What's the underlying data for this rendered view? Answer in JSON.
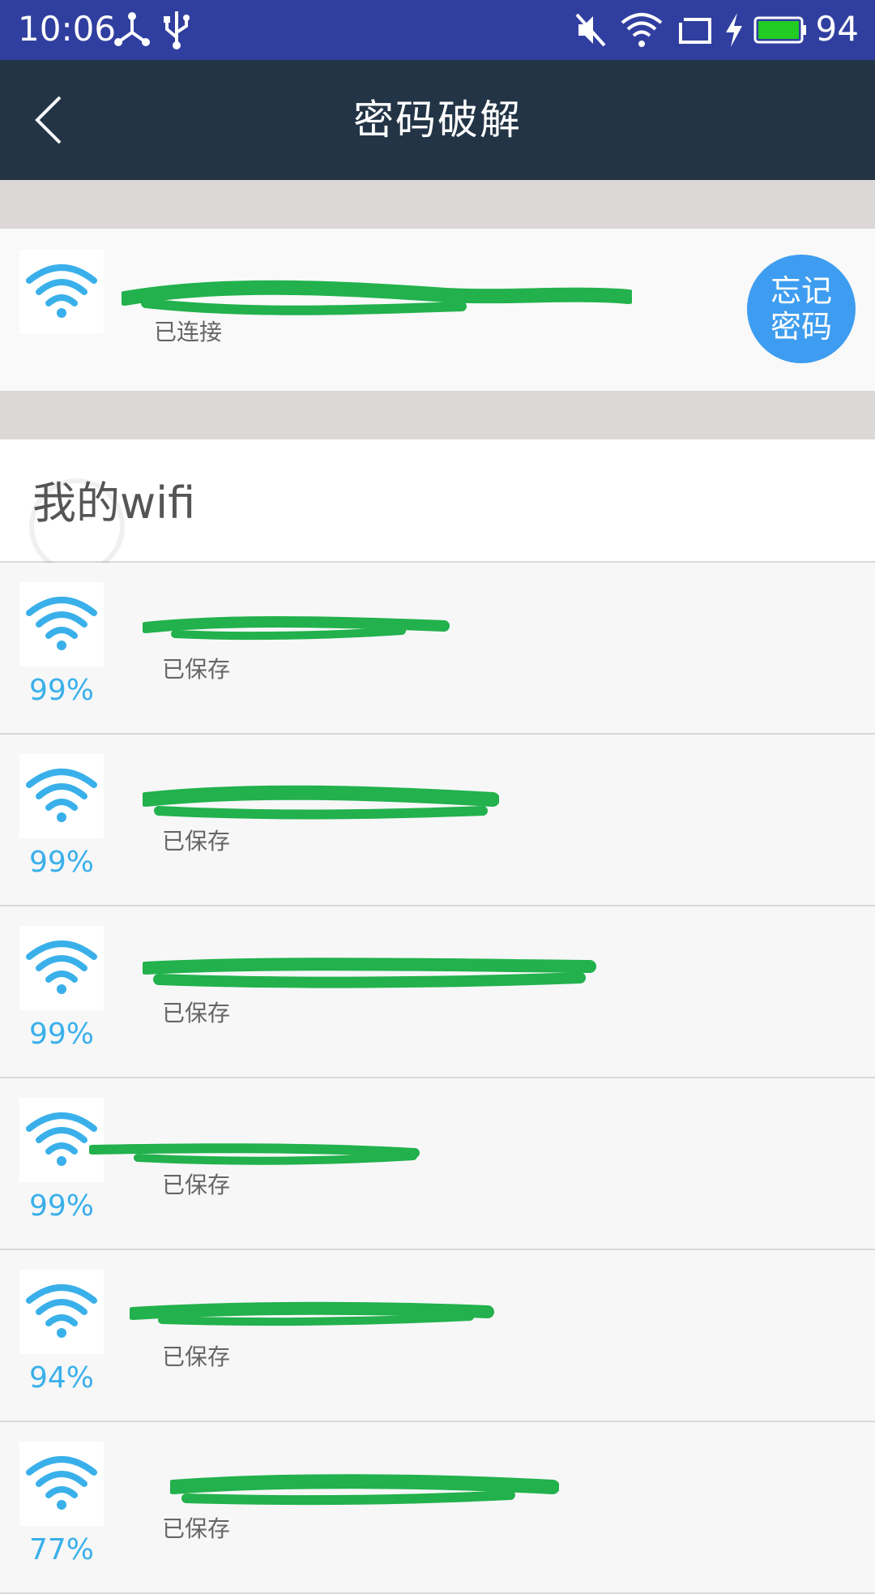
{
  "status_bar": {
    "time": "10:06",
    "battery_level": "94",
    "icons": [
      "network-share-icon",
      "usb-icon",
      "mute-icon",
      "wifi-signal-icon",
      "cast-icon",
      "charging-icon",
      "battery-icon"
    ],
    "colors": {
      "background": "#303f9f",
      "battery_fill": "#22cc22"
    }
  },
  "toolbar": {
    "title": "密码破解",
    "back_icon": "back-arrow-icon",
    "background": "#233446"
  },
  "connected": {
    "status": "已连接",
    "forget_button": "忘记密码",
    "forget_color": "#3e9df0"
  },
  "section": {
    "title": "我的wifi"
  },
  "networks": [
    {
      "signal": "99%",
      "status": "已保存"
    },
    {
      "signal": "99%",
      "status": "已保存"
    },
    {
      "signal": "99%",
      "status": "已保存"
    },
    {
      "signal": "99%",
      "status": "已保存"
    },
    {
      "signal": "94%",
      "status": "已保存"
    },
    {
      "signal": "77%",
      "status": "已保存"
    }
  ],
  "colors": {
    "wifi_icon": "#3ab0ea",
    "redaction": "#22b14c"
  }
}
